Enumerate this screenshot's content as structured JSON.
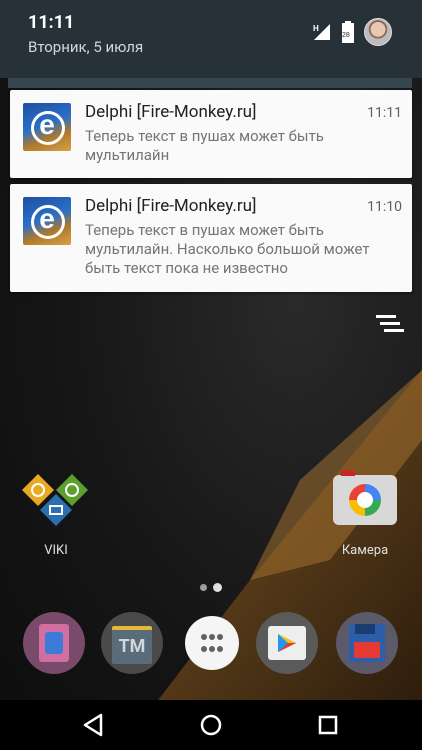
{
  "status": {
    "time": "11:11",
    "date": "Вторник, 5 июля",
    "network": "H",
    "battery_level": "28",
    "icons": [
      "signal-icon",
      "battery-icon",
      "avatar"
    ]
  },
  "notifications": [
    {
      "app": "Delphi [Fire-Monkey.ru]",
      "time": "11:11",
      "text": "Теперь текст в пушах может быть мультилайн",
      "icon": "fire-monkey-app-icon"
    },
    {
      "app": "Delphi [Fire-Monkey.ru]",
      "time": "11:10",
      "text": "Теперь текст в пушах может быть мультилайн. Насколько большой может быть текст пока не известно",
      "icon": "fire-monkey-app-icon"
    }
  ],
  "home": {
    "apps": [
      {
        "label": "VIKI",
        "icon": "viki-icon"
      },
      {
        "label": "Камера",
        "icon": "camera-icon"
      }
    ],
    "dock": [
      {
        "icon": "contacts-icon"
      },
      {
        "icon": "tm-icon",
        "label": "TM"
      },
      {
        "icon": "app-drawer-icon"
      },
      {
        "icon": "play-store-icon"
      },
      {
        "icon": "save-icon"
      }
    ],
    "page_count": 2
  },
  "navbar": [
    "back-icon",
    "home-icon",
    "recents-icon"
  ]
}
